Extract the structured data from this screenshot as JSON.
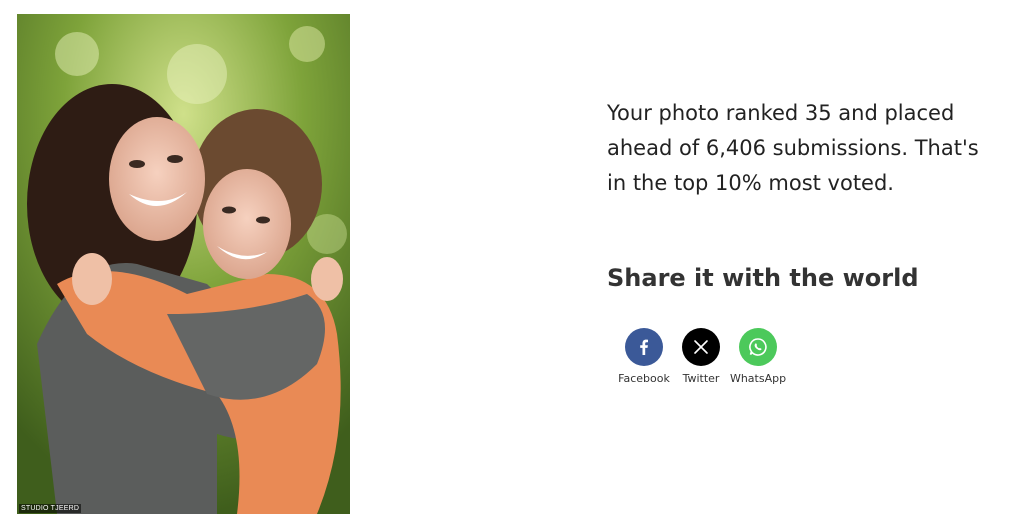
{
  "photo": {
    "alt": "Two smiling young women hugging outdoors",
    "watermark": "STUDIO TJEERD"
  },
  "ranking": {
    "text": "Your photo ranked 35 and placed ahead of 6,406 submissions. That's in the top 10% most voted."
  },
  "share": {
    "heading": "Share it with the world",
    "buttons": [
      {
        "label": "Facebook",
        "icon": "facebook-icon",
        "color": "#3b5998"
      },
      {
        "label": "Twitter",
        "icon": "x-icon",
        "color": "#000000"
      },
      {
        "label": "WhatsApp",
        "icon": "whatsapp-icon",
        "color": "#4cc95b"
      }
    ]
  }
}
